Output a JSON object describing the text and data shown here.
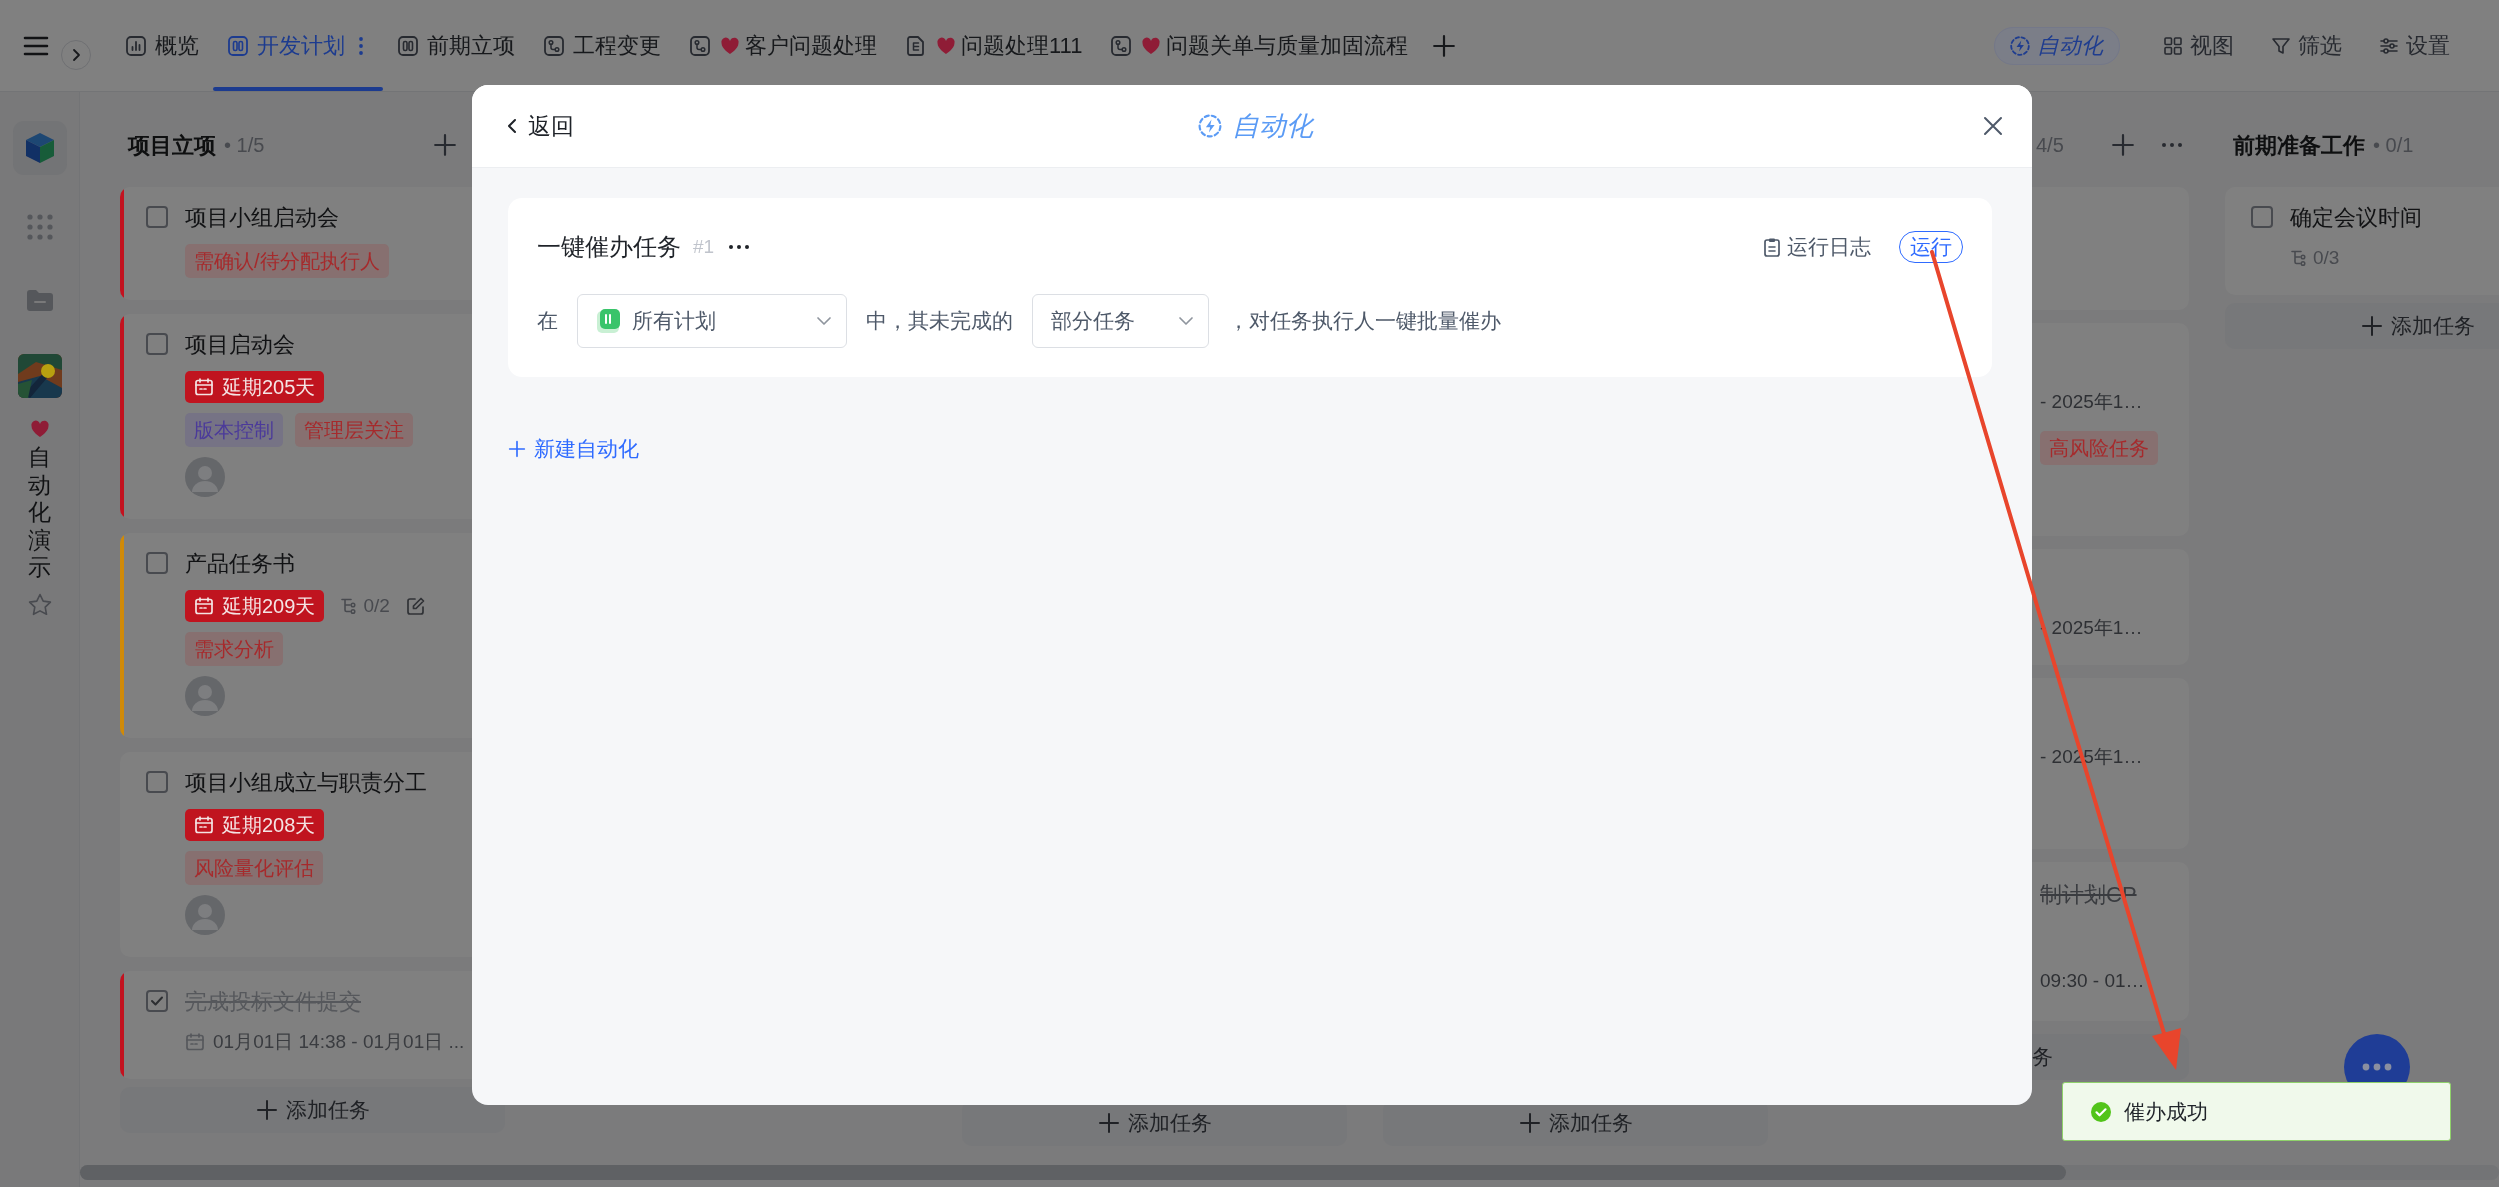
{
  "top_bar": {
    "tabs": [
      {
        "label": "概览",
        "heart": false,
        "selected": false
      },
      {
        "label": "开发计划",
        "heart": false,
        "selected": true
      },
      {
        "label": "前期立项",
        "heart": false,
        "selected": false
      },
      {
        "label": "工程变更",
        "heart": false,
        "selected": false
      },
      {
        "label": "客户问题处理",
        "heart": true,
        "selected": false
      },
      {
        "label": "问题处理111",
        "heart": true,
        "selected": false
      },
      {
        "label": "问题关单与质量加固流程",
        "heart": true,
        "selected": false
      }
    ],
    "tools": [
      {
        "label": "自动化",
        "selected": true
      },
      {
        "label": "视图",
        "selected": false
      },
      {
        "label": "筛选",
        "selected": false
      },
      {
        "label": "设置",
        "selected": false
      }
    ]
  },
  "sidebar": {
    "project_name": "自动化演示",
    "favorite": false
  },
  "board": {
    "columns": [
      {
        "kind": "list",
        "title": "项目立项",
        "count": "• 1/5",
        "add_button": true,
        "cards": [
          {
            "title": "项目小组启动会",
            "done": false,
            "color": "#c3121f",
            "editable": false,
            "avatar": false,
            "tags": [
              {
                "label": "需确认/待分配执行人",
                "color": "#a62a2c"
              }
            ]
          },
          {
            "title": "项目启动会",
            "done": false,
            "color": "#c3121f",
            "delay": "延期205天",
            "editable": false,
            "avatar": true,
            "tags": [
              {
                "label": "版本控制",
                "color": "#4b3a9a"
              },
              {
                "label": "管理层关注",
                "color": "#a62a2c"
              }
            ]
          },
          {
            "title": "产品任务书",
            "done": false,
            "color": "#d08a08",
            "delay": "延期209天",
            "subtasks": "0/2",
            "editable": true,
            "avatar": true,
            "tags": [
              {
                "label": "需求分析",
                "color": "#a62a2c"
              }
            ]
          },
          {
            "title": "项目小组成立与职责分工",
            "done": false,
            "delay": "延期208天",
            "editable": false,
            "avatar": true,
            "tags": [
              {
                "label": "风险量化评估",
                "color": "#a62a2c"
              }
            ]
          },
          {
            "title": "完成投标文件提交",
            "done": true,
            "color": "#c3121f",
            "editable": false,
            "avatar": false,
            "date": "01月01日 14:38 - 01月01日 ..."
          }
        ],
        "add_task": "添加任务"
      },
      {
        "kind": "covered"
      },
      {
        "kind": "covered",
        "add_task": "添加任务"
      },
      {
        "kind": "covered",
        "add_task": "添加任务"
      },
      {
        "kind": "partial",
        "count": "4/5",
        "add_button": true,
        "cards": [
          {
            "kind": "blank"
          },
          {
            "kind": "clipped",
            "date": "- 2025年1…",
            "tags": [
              {
                "label": "高风险任务",
                "color": "#a62a2c"
              }
            ]
          },
          {
            "kind": "clipped",
            "date": "- 2025年1…"
          },
          {
            "kind": "clipped",
            "date": "- 2025年1…"
          },
          {
            "kind": "clipped",
            "title": "制计划CP",
            "done": true,
            "date": "09:30 - 01…"
          }
        ],
        "add_task": "务"
      },
      {
        "kind": "list",
        "title": "前期准备工作",
        "count": "• 0/1",
        "cards": [
          {
            "title": "确定会议时间",
            "done": false,
            "subtasks": "0/3",
            "editable": false,
            "avatar": false
          }
        ],
        "add_task": "添加任务"
      }
    ]
  },
  "modal": {
    "back": "返回",
    "title": "自动化",
    "rules": [
      {
        "name": "一键催办任务",
        "number": "#1",
        "log": "运行日志",
        "run": "运行",
        "clauses": [
          {
            "kind": "text",
            "text": "在"
          },
          {
            "kind": "select",
            "value": "所有计划"
          },
          {
            "kind": "text",
            "text": "中，其未完成的"
          },
          {
            "kind": "select",
            "value": "部分任务"
          },
          {
            "kind": "text",
            "text": "，对任务执行人一键批量催办"
          }
        ]
      }
    ],
    "new_label": "新建自动化"
  },
  "toast": {
    "kind": "success",
    "message": "催办成功"
  },
  "annotation": {
    "kind": "arrow"
  }
}
